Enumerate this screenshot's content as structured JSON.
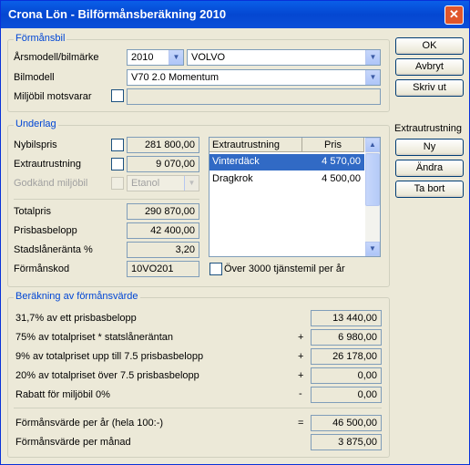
{
  "window": {
    "title": "Crona Lön - Bilförmånsberäkning 2010",
    "close_glyph": "✕"
  },
  "formansbil": {
    "legend": "Förmånsbil",
    "arsmodell_label": "Årsmodell/bilmärke",
    "arsmodell_value": "2010",
    "bilmarke_value": "VOLVO",
    "bilmodell_label": "Bilmodell",
    "bilmodell_value": "V70 2.0 Momentum",
    "miljobil_label": "Miljöbil motsvarar",
    "miljobil_value": ""
  },
  "underlag": {
    "legend": "Underlag",
    "nybilspris_label": "Nybilspris",
    "nybilspris_value": "281 800,00",
    "extrautrustning_label": "Extrautrustning",
    "extrautrustning_value": "9 070,00",
    "godkand_label": "Godkänd miljöbil",
    "godkand_value": "Etanol",
    "totalpris_label": "Totalpris",
    "totalpris_value": "290 870,00",
    "prisbasbelopp_label": "Prisbasbelopp",
    "prisbasbelopp_value": "42 400,00",
    "stadslaneranta_label": "Stadslåneränta %",
    "stadslaneranta_value": "3,20",
    "formanskod_label": "Förmånskod",
    "formanskod_value": "10VO201",
    "over3000_label": "Över 3000 tjänstemil per år",
    "list": {
      "headers": [
        "Extrautrustning",
        "Pris"
      ],
      "rows": [
        {
          "name": "Vinterdäck",
          "price": "4 570,00"
        },
        {
          "name": "Dragkrok",
          "price": "4 500,00"
        }
      ]
    }
  },
  "berakning": {
    "legend": "Beräkning av förmånsvärde",
    "rows": [
      {
        "label": "31,7% av ett prisbasbelopp",
        "op": "",
        "value": "13 440,00"
      },
      {
        "label": "75% av totalpriset * statslåneräntan",
        "op": "+",
        "value": "6 980,00"
      },
      {
        "label": "9% av totalpriset upp till 7.5 prisbasbelopp",
        "op": "+",
        "value": "26 178,00"
      },
      {
        "label": "20% av totalpriset över 7.5 prisbasbelopp",
        "op": "+",
        "value": "0,00"
      },
      {
        "label": "Rabatt för miljöbil 0%",
        "op": "-",
        "value": "0,00"
      }
    ],
    "per_ar_label": "Förmånsvärde per år (hela 100:-)",
    "per_ar_op": "=",
    "per_ar_value": "46 500,00",
    "per_manad_label": "Förmånsvärde per månad",
    "per_manad_value": "3 875,00"
  },
  "buttons": {
    "ok": "OK",
    "avbryt": "Avbryt",
    "skriv_ut": "Skriv ut",
    "extra_heading": "Extrautrustning",
    "ny": "Ny",
    "andra": "Ändra",
    "ta_bort": "Ta bort"
  }
}
